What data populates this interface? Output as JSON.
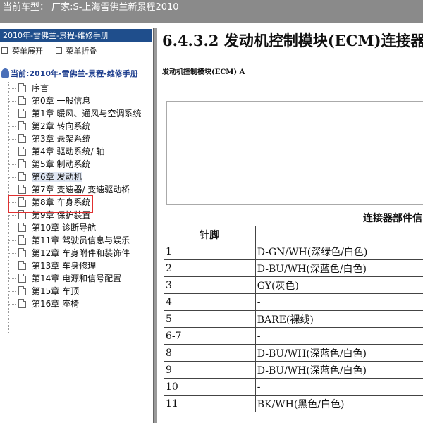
{
  "topbar": {
    "text": "当前车型： 厂家:S-上海雪佛兰新景程2010"
  },
  "sidebar": {
    "title": "2010年-雪佛兰-景程-维修手册",
    "expand_label": "菜单展开",
    "collapse_label": "菜单折叠",
    "root_label": "当前:2010年-雪佛兰-景程-维修手册",
    "items": [
      "序言",
      "第0章 一般信息",
      "第1章 暖风、通风与空调系统",
      "第2章 转向系统",
      "第3章 悬架系统",
      "第4章 驱动系统/ 轴",
      "第5章 制动系统",
      "第6章 发动机",
      "第7章 变速器/ 变速驱动桥",
      "第8章 车身系统",
      "第9章 保护装置",
      "第10章 诊断导航",
      "第11章 驾驶员信息与娱乐",
      "第12章 车身附件和装饰件",
      "第13章 车身修理",
      "第14章 电源和信号配置",
      "第15章 车顶",
      "第16章 座椅"
    ],
    "selected_index": 7
  },
  "content": {
    "title": "6.4.3.2 发动机控制模块(ECM)连接器",
    "subheading": "发动机控制模块(ECM) A",
    "table_header": "连接器部件信",
    "pin_header": "针脚",
    "rows": [
      {
        "pin": "1",
        "wire": "D-GN/WH(深绿色/白色)"
      },
      {
        "pin": "2",
        "wire": "D-BU/WH(深蓝色/白色)"
      },
      {
        "pin": "3",
        "wire": "GY(灰色)"
      },
      {
        "pin": "4",
        "wire": "-"
      },
      {
        "pin": "5",
        "wire": "BARE(裸线)"
      },
      {
        "pin": "6-7",
        "wire": "-"
      },
      {
        "pin": "8",
        "wire": "D-BU/WH(深蓝色/白色)"
      },
      {
        "pin": "9",
        "wire": "D-BU/WH(深蓝色/白色)"
      },
      {
        "pin": "10",
        "wire": "-"
      },
      {
        "pin": "11",
        "wire": "BK/WH(黑色/白色)"
      }
    ]
  }
}
